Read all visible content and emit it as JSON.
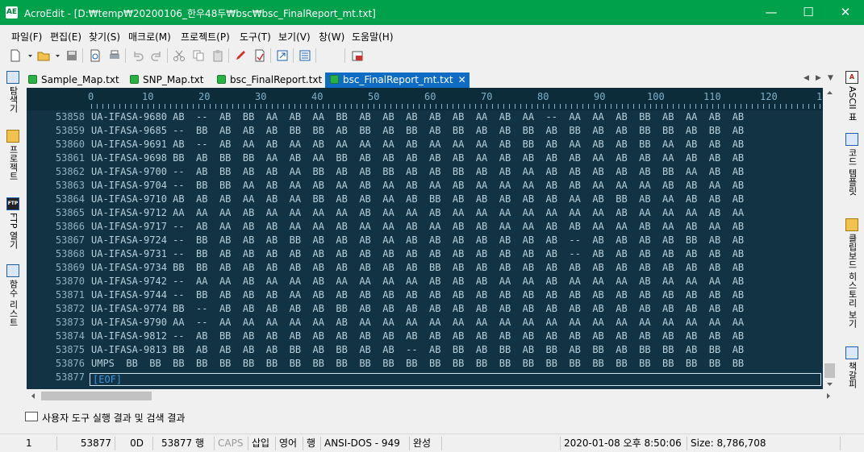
{
  "window": {
    "app_icon": "AE",
    "title": "AcroEdit - [D:₩temp₩20200106_한우48두₩bsc₩bsc_FinalReport_mt.txt]",
    "minimize": "—",
    "maximize": "☐",
    "close": "✕"
  },
  "menu": [
    "파일(F)",
    "편집(E)",
    "찾기(S)",
    "매크로(M)",
    "프로젝트(P)",
    "도구(T)",
    "보기(V)",
    "창(W)",
    "도움말(H)"
  ],
  "left_panel": [
    "탐색기",
    "프로젝트",
    "FTP 열기",
    "함수 리스트"
  ],
  "right_panel": [
    "ASCII 표",
    "코드 템플릿",
    "클립보드 히스토리 보기",
    "책갈피"
  ],
  "left_icons": [
    "explorer-icon",
    "project-icon",
    "ftp-icon",
    "function-list-icon"
  ],
  "right_icons": [
    "ascii-table-icon",
    "code-template-icon",
    "clipboard-history-icon",
    "bookmark-icon"
  ],
  "tabs": [
    {
      "label": "Sample_Map.txt",
      "active": false
    },
    {
      "label": "SNP_Map.txt",
      "active": false
    },
    {
      "label": "bsc_FinalReport.txt",
      "active": false
    },
    {
      "label": "bsc_FinalReport_mt.txt",
      "active": true
    }
  ],
  "tab_close": "✕",
  "tab_nav": [
    "◀",
    "▶",
    "▼"
  ],
  "ruler": [
    "0",
    "10",
    "20",
    "30",
    "40",
    "50",
    "60",
    "70",
    "80",
    "90",
    "100",
    "110",
    "120",
    "1"
  ],
  "line_numbers": [
    "53858",
    "53859",
    "53860",
    "53861",
    "53862",
    "53863",
    "53864",
    "53865",
    "53866",
    "53867",
    "53868",
    "53869",
    "53870",
    "53871",
    "53872",
    "53873",
    "53874",
    "53875",
    "53876",
    "53877"
  ],
  "lines": [
    "UA-IFASA-9680 AB  --  AB  BB  AA  AB  AA  BB  AB  AB  AB  AB  AB  AA  AB  AA  --  AA  AA  AB  BB  AB  AA  AB  AB",
    "UA-IFASA-9685 --  BB  AB  AB  AB  BB  BB  AB  BB  AB  BB  AB  BB  AB  AB  BB  AB  BB  AB  AB  BB  BB  AB  BB  AB",
    "UA-IFASA-9691 AB  --  AB  AA  AB  AA  AB  AA  AA  AA  AB  AA  AA  AA  AB  BB  AB  AA  AB  AB  BB  AA  AB  AB  AB",
    "UA-IFASA-9698 BB  AB  BB  BB  AA  AB  AA  BB  AB  AB  AB  AB  AB  AA  AB  AB  AB  AB  AA  AB  AB  AA  AB  AB  AB",
    "UA-IFASA-9700 --  AB  BB  AB  AB  AA  BB  AB  AB  BB  AB  AB  BB  AB  AB  AA  AB  AB  AB  AB  AB  BB  AA  AB  AB",
    "UA-IFASA-9704 --  BB  BB  AA  AB  AA  AB  AA  AB  AA  AB  AA  AB  AA  AA  AA  AB  AB  AA  AA  AA  AB  AB  AA  AB",
    "UA-IFASA-9710 AB  AB  AB  AA  AB  AA  BB  AB  AB  AA  AB  BB  AB  AB  AB  AB  AB  AA  AB  BB  AB  AA  AB  AB  AB",
    "UA-IFASA-9712 AA  AA  AA  AB  AA  AA  AA  AA  AB  AA  AA  AB  AA  AA  AA  AA  AA  AA  AA  AB  AA  AA  AA  AB  AA",
    "UA-IFASA-9717 --  AB  AA  AB  AB  AA  AA  AB  AA  AA  AB  AA  AB  AB  AA  AA  AB  AB  AA  AA  AB  AA  AB  AA  AB",
    "UA-IFASA-9724 --  BB  AB  AB  AB  BB  AB  AB  AB  AA  AB  AB  AB  AB  AB  AB  AB  --  AB  AB  AB  AB  BB  AB  AB",
    "UA-IFASA-9731 --  BB  AB  AB  AB  AB  AB  AB  AB  AB  AB  AB  AB  AB  AB  AB  AB  --  AB  AB  AB  AB  AB  AB  AB",
    "UA-IFASA-9734 BB  BB  AB  AB  AB  AB  AB  AB  AB  AB  AB  BB  AB  AB  AB  AB  AB  AB  AB  AB  AB  AB  AB  AB  AB",
    "UA-IFASA-9742 --  AA  AA  AB  AA  AA  AB  AA  AA  AA  AA  AB  AB  AB  AA  AA  AB  AA  AA  AA  AB  AA  AA  AA  AB",
    "UA-IFASA-9744 --  BB  AB  AB  AB  AA  AB  AB  AB  AB  AB  AB  AB  AB  AB  AB  AB  AB  AB  AB  AB  AB  AB  AB  AB",
    "UA-IFASA-9774 BB  --  AB  AB  AB  AB  AB  BB  AB  AB  AB  AB  AB  AB  AB  AB  AB  AB  AB  AB  AB  AB  AB  AB  AB",
    "UA-IFASA-9790 AA  --  AA  AA  AA  AA  AA  AB  AA  AA  AA  AA  AA  AA  AA  AA  AA  AA  AA  AA  AA  AA  AA  AA  AA",
    "UA-IFASA-9812 --  AB  BB  AB  AB  AB  AB  AB  AB  AB  AB  AB  AB  AB  AB  AB  AB  AB  AB  AB  AB  AB  AB  AB  AB",
    "UA-IFASA-9813 BB  AB  AB  AB  AB  BB  AB  BB  AB  AB  --  AB  BB  AB  BB  AB  BB  AB  BB  AB  BB  BB  AB  BB  AB",
    "UMPS  BB  BB  BB  BB  BB  BB  BB  BB  BB  BB  BB  BB  BB  BB  BB  BB  BB  BB  BB  BB  BB  BB  BB  BB  BB  BB  BB"
  ],
  "eof": "[EOF]",
  "output_panel": {
    "icon": "output-icon",
    "label": "사용자 도구 실행 결과 및 검색 결과"
  },
  "status": {
    "column": "1",
    "line": "53877",
    "char_code": "0D",
    "line_count": "53877 행",
    "caps": "CAPS",
    "insert": "삽입",
    "lang": "영어",
    "mode": "행",
    "encoding": "ANSI-DOS - 949",
    "state": "완성",
    "datetime": "2020-01-08 오후 8:50:06",
    "size": "Size: 8,786,708"
  }
}
